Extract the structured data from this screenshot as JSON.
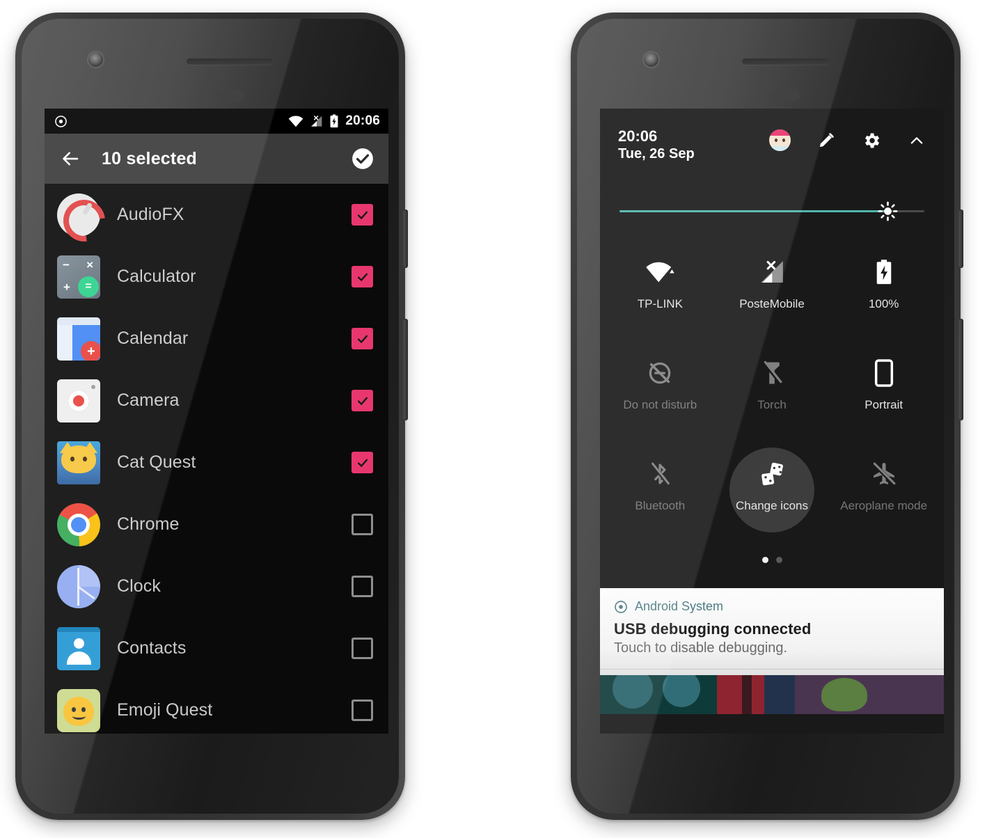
{
  "left_phone": {
    "status_bar": {
      "time": "20:06",
      "icons": [
        "record-dot-icon",
        "wifi-icon",
        "cell-signal-off-icon",
        "battery-charging-icon"
      ]
    },
    "app_bar": {
      "back_icon": "arrow-left-icon",
      "title": "10 selected",
      "done_icon": "check-circle-icon"
    },
    "apps": [
      {
        "name": "AudioFX",
        "icon": "audiofx-icon",
        "checked": true
      },
      {
        "name": "Calculator",
        "icon": "calculator-icon",
        "checked": true
      },
      {
        "name": "Calendar",
        "icon": "calendar-icon",
        "checked": true
      },
      {
        "name": "Camera",
        "icon": "camera-icon",
        "checked": true
      },
      {
        "name": "Cat Quest",
        "icon": "cat-quest-icon",
        "checked": true
      },
      {
        "name": "Chrome",
        "icon": "chrome-icon",
        "checked": false
      },
      {
        "name": "Clock",
        "icon": "clock-icon",
        "checked": false
      },
      {
        "name": "Contacts",
        "icon": "contacts-icon",
        "checked": false
      },
      {
        "name": "Emoji Quest",
        "icon": "emoji-quest-icon",
        "checked": false
      }
    ],
    "colors": {
      "checkbox_checked": "#e8376f",
      "appbar_bg": "#3a3a3a",
      "list_bg": "#0a0a0a"
    }
  },
  "right_phone": {
    "header": {
      "time": "20:06",
      "date": "Tue, 26 Sep",
      "actions": [
        "avatar",
        "edit-pencil-icon",
        "settings-gear-icon",
        "chevron-up-icon"
      ]
    },
    "brightness": {
      "icon": "brightness-sun-icon",
      "value_percent": 88,
      "fill_color": "#4fb7ae"
    },
    "tiles": [
      {
        "label": "TP-LINK",
        "icon": "wifi-icon",
        "active": true,
        "highlight": false
      },
      {
        "label": "PosteMobile",
        "icon": "cell-signal-off-icon",
        "active": true,
        "highlight": false
      },
      {
        "label": "100%",
        "icon": "battery-charging-icon",
        "active": true,
        "highlight": false
      },
      {
        "label": "Do not disturb",
        "icon": "dnd-off-icon",
        "active": false,
        "highlight": false
      },
      {
        "label": "Torch",
        "icon": "torch-off-icon",
        "active": false,
        "highlight": false
      },
      {
        "label": "Portrait",
        "icon": "rotation-portrait-icon",
        "active": true,
        "highlight": false
      },
      {
        "label": "Bluetooth",
        "icon": "bluetooth-off-icon",
        "active": false,
        "highlight": false
      },
      {
        "label": "Change icons",
        "icon": "dice-icon",
        "active": true,
        "highlight": true
      },
      {
        "label": "Aeroplane mode",
        "icon": "aeroplane-off-icon",
        "active": false,
        "highlight": false
      }
    ],
    "pager": {
      "pages": 2,
      "current": 1
    },
    "notification": {
      "app_icon": "android-system-icon",
      "source": "Android System",
      "title": "USB debugging connected",
      "body": "Touch to disable debugging."
    }
  }
}
